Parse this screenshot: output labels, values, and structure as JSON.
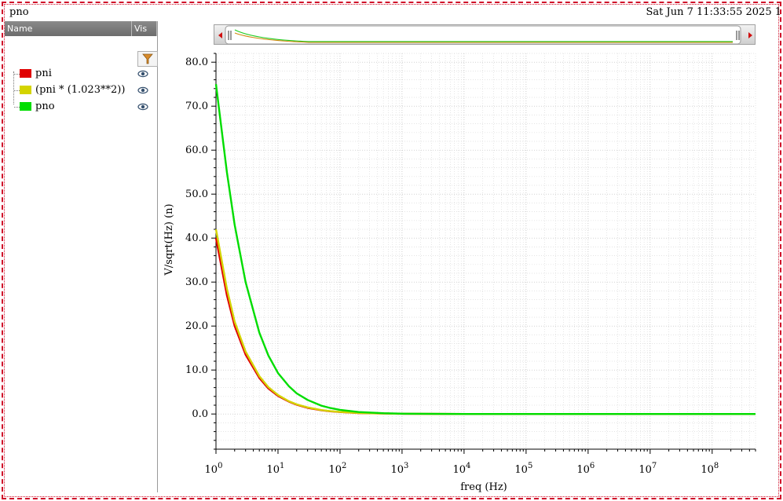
{
  "window": {
    "title": "pno",
    "timestamp": "Sat Jun 7 11:33:55 2025  1"
  },
  "legend_panel": {
    "columns": [
      "Name",
      "Vis"
    ],
    "filter_icon": "filter-funnel-icon",
    "visibility_icon": "eye-icon",
    "items": [
      {
        "label": "pni",
        "color": "#e00000"
      },
      {
        "label": "(pni * (1.023**2))",
        "color": "#d4d400"
      },
      {
        "label": "pno",
        "color": "#00dd00"
      }
    ]
  },
  "chart_data": {
    "type": "line",
    "xlabel": "freq (Hz)",
    "ylabel": "V/sqrt(Hz)  (n)",
    "xscale": "log",
    "xlim": [
      1,
      500000000
    ],
    "ylim": [
      -8,
      82
    ],
    "yticks": [
      "0.0",
      "10.0",
      "20.0",
      "30.0",
      "40.0",
      "50.0",
      "60.0",
      "70.0",
      "80.0"
    ],
    "xticks": [
      {
        "base": "10",
        "exp": "0"
      },
      {
        "base": "10",
        "exp": "1"
      },
      {
        "base": "10",
        "exp": "2"
      },
      {
        "base": "10",
        "exp": "3"
      },
      {
        "base": "10",
        "exp": "4"
      },
      {
        "base": "10",
        "exp": "5"
      },
      {
        "base": "10",
        "exp": "6"
      },
      {
        "base": "10",
        "exp": "7"
      },
      {
        "base": "10",
        "exp": "8"
      }
    ],
    "grid": true,
    "series": [
      {
        "name": "pni",
        "color": "#e00000",
        "x": [
          1,
          1.5,
          2,
          3,
          5,
          7,
          10,
          15,
          20,
          30,
          50,
          70,
          100,
          200,
          500,
          1000,
          10000,
          100000,
          1000000,
          10000000,
          100000000,
          500000000
        ],
        "y": [
          40,
          27,
          20,
          13.5,
          8.2,
          5.8,
          4.1,
          2.8,
          2.1,
          1.4,
          0.85,
          0.6,
          0.45,
          0.22,
          0.1,
          0.05,
          0,
          0,
          0,
          0,
          0,
          0
        ]
      },
      {
        "name": "(pni * (1.023**2))",
        "color": "#d4d400",
        "x": [
          1,
          1.5,
          2,
          3,
          5,
          7,
          10,
          15,
          20,
          30,
          50,
          70,
          100,
          200,
          500,
          1000,
          10000,
          100000,
          1000000,
          10000000,
          100000000,
          500000000
        ],
        "y": [
          42,
          28.5,
          21,
          14.2,
          8.6,
          6.1,
          4.3,
          2.9,
          2.2,
          1.5,
          0.9,
          0.65,
          0.47,
          0.23,
          0.1,
          0.05,
          0,
          0,
          0,
          0,
          0,
          0
        ]
      },
      {
        "name": "pno",
        "color": "#00dd00",
        "x": [
          1,
          1.5,
          2,
          3,
          5,
          7,
          10,
          15,
          20,
          30,
          50,
          70,
          100,
          200,
          500,
          1000,
          10000,
          100000,
          1000000,
          10000000,
          100000000,
          500000000
        ],
        "y": [
          75,
          55,
          43,
          30,
          18.5,
          13.3,
          9.3,
          6.3,
          4.7,
          3.2,
          1.9,
          1.35,
          0.95,
          0.45,
          0.18,
          0.08,
          0,
          0,
          0,
          0,
          0,
          0
        ]
      }
    ]
  }
}
